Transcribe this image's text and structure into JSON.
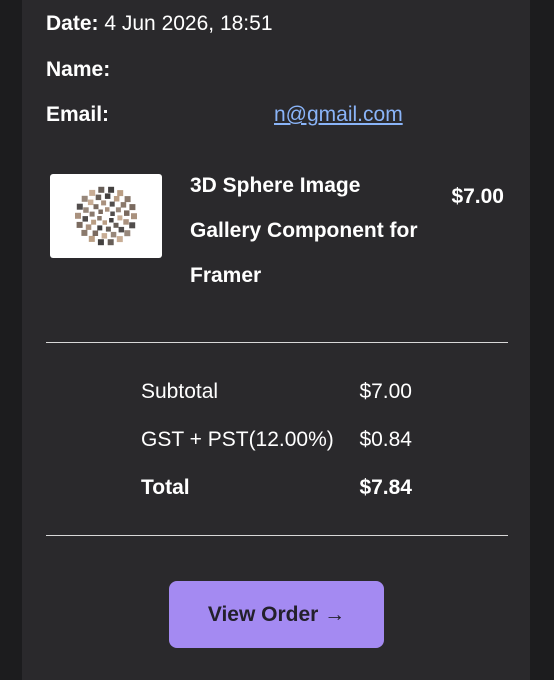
{
  "receipt": {
    "date_label": "Date:",
    "date_value": "4 Jun 2026, 18:51",
    "name_label": "Name:",
    "name_value": "",
    "email_label": "Email:",
    "email_value": "n@gmail.com"
  },
  "item": {
    "title_line1": "3D Sphere Image",
    "title_line2": "Gallery Component for",
    "title_line3": "Framer",
    "price": "$7.00"
  },
  "summary": {
    "subtotal_label": "Subtotal",
    "subtotal_value": "$7.00",
    "tax_label": "GST + PST(12.00%)",
    "tax_value": "$0.84",
    "total_label": "Total",
    "total_value": "$7.84"
  },
  "actions": {
    "view_order_label": "View Order →"
  },
  "colors": {
    "background": "#1c1c1e",
    "card": "#2a292c",
    "accent_button": "#a48af2",
    "link": "#8ab4f8"
  }
}
